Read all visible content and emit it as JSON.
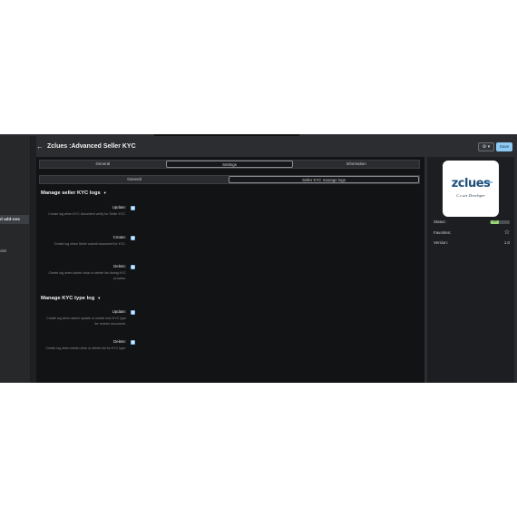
{
  "sidebar": {
    "active_item": "d add-ons",
    "item2": "olet"
  },
  "header": {
    "back_icon": "←",
    "title": "Zclues :Advanced Seller KYC",
    "gear_label": "⚙ ▾",
    "save_label": "Save"
  },
  "tabs": [
    {
      "label": "General"
    },
    {
      "label": "Settings"
    },
    {
      "label": "Information"
    }
  ],
  "subtabs": [
    {
      "label": "General"
    },
    {
      "label": "Seller KYC manage logs"
    }
  ],
  "sections": [
    {
      "title": "Manage seller KYC logs",
      "fields": [
        {
          "label": "Update:",
          "desc": "Create log when KYC document verify for Seller KYC."
        },
        {
          "label": "Create:",
          "desc": "Create log when Seller submit document for KYC."
        },
        {
          "label": "Delete:",
          "desc": "Create log when admin clear or delete list during KYC process."
        }
      ]
    },
    {
      "title": "Manage KYC type log",
      "fields": [
        {
          "label": "Update:",
          "desc": "Create log when admin update or create new KYC type for receive document."
        },
        {
          "label": "Delete:",
          "desc": "Create log when admin clear or delete list for KYC type."
        }
      ]
    }
  ],
  "addon_info": {
    "logo_text": "zclues",
    "logo_com": ".com",
    "logo_sub": "C.c.art Developer",
    "status_label": "Status:",
    "status_value": "ON",
    "favorites_label": "Favorites:",
    "version_label": "Version:",
    "version_value": "1.0"
  },
  "colors": {
    "accent": "#8cc9f2",
    "toggle_on": "#9ad97a",
    "background": "#111315"
  }
}
